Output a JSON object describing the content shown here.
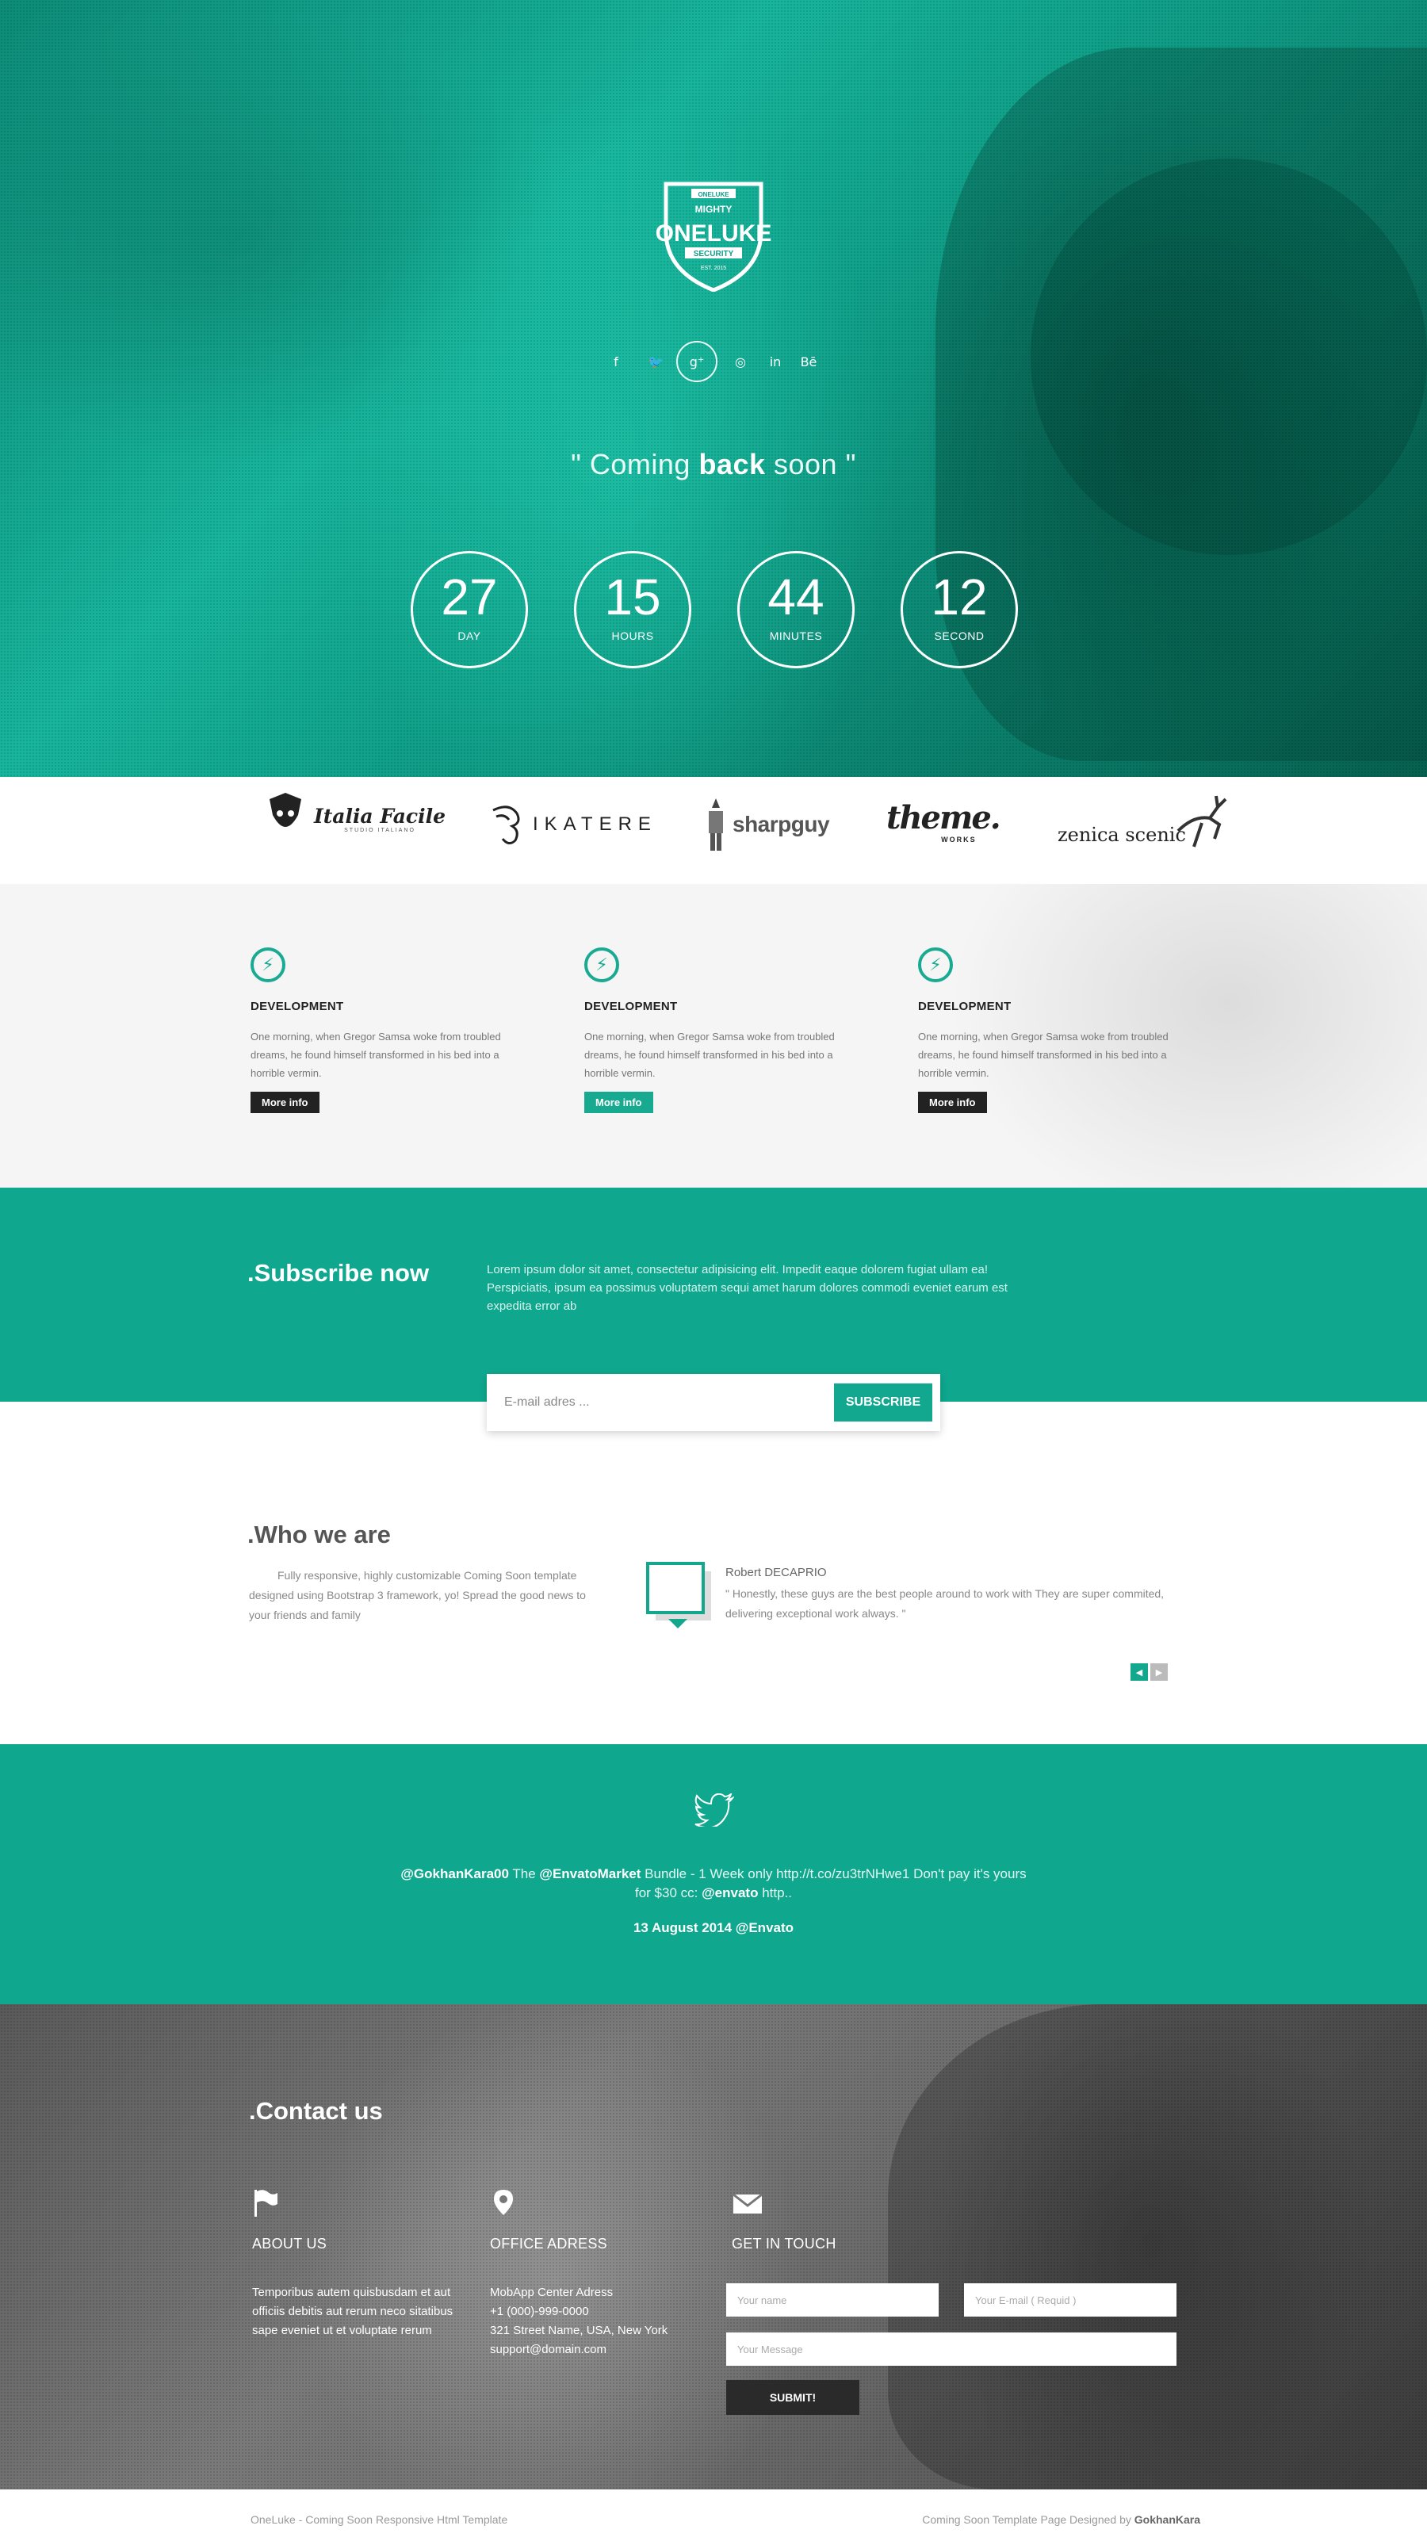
{
  "hero": {
    "logo_top": "ONELUKE",
    "logo_mighty": "MIGHTY",
    "logo_name": "ONELUKE",
    "logo_security": "SECURITY",
    "logo_year": "EST. 2015",
    "social": [
      {
        "icon": "facebook-icon",
        "glyph": "f"
      },
      {
        "icon": "twitter-icon",
        "glyph": "🐦"
      },
      {
        "icon": "google-plus-icon",
        "glyph": "g⁺"
      },
      {
        "icon": "dribbble-icon",
        "glyph": "◎"
      },
      {
        "icon": "linkedin-icon",
        "glyph": "in"
      },
      {
        "icon": "behance-icon",
        "glyph": "Bē"
      }
    ],
    "tagline_open": "\" Coming ",
    "tagline_bold": "back",
    "tagline_close": " soon \"",
    "countdown": [
      {
        "value": "27",
        "label": "DAY"
      },
      {
        "value": "15",
        "label": "HOURS"
      },
      {
        "value": "44",
        "label": "MINUTES"
      },
      {
        "value": "12",
        "label": "SECOND"
      }
    ]
  },
  "clients": [
    {
      "name": "Italia Facile",
      "sub": "STUDIO ITALIANO"
    },
    {
      "name": "IKATERE"
    },
    {
      "name": "sharpguy"
    },
    {
      "name": "theme.",
      "sub": "WORKS"
    },
    {
      "name": "zenica scenic"
    }
  ],
  "services": [
    {
      "title": "DEVELOPMENT",
      "text": "One morning, when Gregor Samsa woke from troubled dreams, he found himself transformed in his bed into a horrible vermin.",
      "button": "More info"
    },
    {
      "title": "DEVELOPMENT",
      "text": "One morning, when Gregor Samsa woke from troubled dreams, he found himself transformed in his bed into a horrible vermin.",
      "button": "More info"
    },
    {
      "title": "DEVELOPMENT",
      "text": "One morning, when Gregor Samsa woke from troubled dreams, he found himself transformed in his bed into a horrible vermin.",
      "button": "More info"
    }
  ],
  "subscribe": {
    "title": ".Subscribe now",
    "text": "Lorem ipsum dolor sit amet, consectetur adipisicing elit. Impedit eaque dolorem fugiat ullam ea! Perspiciatis, ipsum ea possimus voluptatem sequi amet harum dolores commodi eveniet earum est expedita error ab",
    "placeholder": "E-mail adres ...",
    "button": "SUBSCRIBE"
  },
  "who": {
    "title": ".Who we are",
    "text": "Fully responsive, highly customizable Coming Soon template designed using Bootstrap 3 framework, yo! Spread the good news to your friends and family",
    "testimonial_name": "Robert DECAPRIO",
    "testimonial_text": "\" Honestly, these guys are the best people around to work with They are super commited, delivering exceptional work always. \""
  },
  "twitter": {
    "handle": "@GokhanKara00",
    "t1": " The ",
    "market": "@EnvatoMarket",
    "t2": " Bundle - 1 Week only http://t.co/zu3trNHwe1 Don't pay it's yours for $30 cc: ",
    "envato": "@envato",
    "t3": " http..",
    "date": "13 August 2014 @Envato"
  },
  "contact": {
    "title": ".Contact us",
    "about_head": "ABOUT US",
    "about_text": "Temporibus autem quisbusdam et aut officiis debitis aut rerum neco sitatibus sape eveniet ut et voluptate rerum",
    "office_head": "OFFICE ADRESS",
    "office_lines": [
      "MobApp Center Adress",
      "+1 (000)-999-0000",
      "321 Street Name, USA, New York",
      "support@domain.com"
    ],
    "touch_head": "GET IN TOUCH",
    "name_placeholder": "Your name",
    "email_placeholder": "Your E-mail ( Requid )",
    "message_placeholder": "Your Message",
    "submit": "SUBMIT!"
  },
  "footer": {
    "left": "OneLuke - Coming Soon Responsive Html Template",
    "right_text": "Coming Soon Template Page Designed by ",
    "right_author": "GokhanKara"
  },
  "colors": {
    "accent": "#0fa88e",
    "dark": "#222222"
  }
}
